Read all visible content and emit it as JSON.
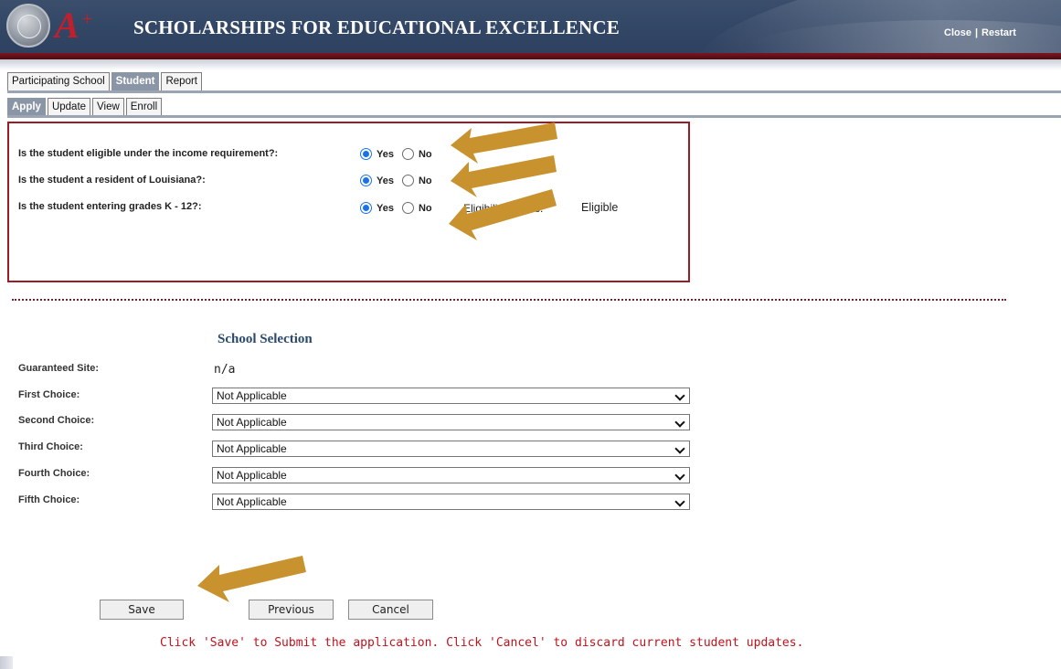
{
  "header": {
    "title": "SCHOLARSHIPS FOR EDUCATIONAL EXCELLENCE",
    "logo_text": "A",
    "logo_plus": "+",
    "close_label": "Close",
    "separator": "|",
    "restart_label": "Restart"
  },
  "tabs_primary": [
    {
      "label": "Participating School",
      "active": false
    },
    {
      "label": "Student",
      "active": true
    },
    {
      "label": "Report",
      "active": false
    }
  ],
  "tabs_secondary": [
    {
      "label": "Apply",
      "active": true
    },
    {
      "label": "Update",
      "active": false
    },
    {
      "label": "View",
      "active": false
    },
    {
      "label": "Enroll",
      "active": false
    }
  ],
  "eligibility": {
    "questions": [
      {
        "label": "Is the student eligible under the income requirement?:",
        "selected": "Yes"
      },
      {
        "label": "Is the student a resident of Louisiana?:",
        "selected": "Yes"
      },
      {
        "label": "Is the student entering grades K - 12?:",
        "selected": "Yes"
      }
    ],
    "yes_label": "Yes",
    "no_label": "No",
    "status_label": "Eligibility Status:",
    "status_value": "Eligible"
  },
  "school_selection": {
    "title": "School Selection",
    "guaranteed_label": "Guaranteed Site:",
    "guaranteed_value": "n/a",
    "choices": [
      {
        "label": "First Choice:",
        "value": "Not Applicable"
      },
      {
        "label": "Second Choice:",
        "value": "Not Applicable"
      },
      {
        "label": "Third Choice:",
        "value": "Not Applicable"
      },
      {
        "label": "Fourth Choice:",
        "value": "Not Applicable"
      },
      {
        "label": "Fifth Choice:",
        "value": "Not Applicable"
      }
    ]
  },
  "buttons": {
    "save": "Save",
    "previous": "Previous",
    "cancel": "Cancel"
  },
  "footer_message": "Click 'Save' to Submit the application. Click 'Cancel' to discard current student updates.",
  "colors": {
    "header_bg": "#334766",
    "header_band": "#7d1620",
    "active_tab": "#8a96a6",
    "box_border": "#9b1c24",
    "footer_text": "#c0121c",
    "arrow": "#c8922f"
  }
}
